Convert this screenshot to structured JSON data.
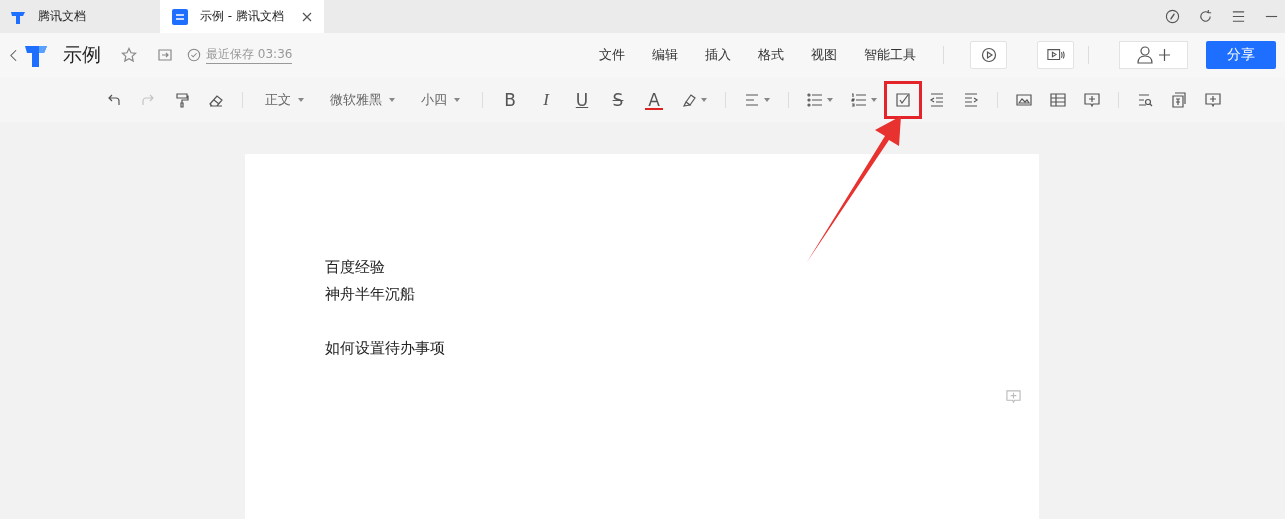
{
  "tabs": [
    {
      "label": "腾讯文档",
      "selected": false,
      "closable": false
    },
    {
      "label": "示例 - 腾讯文档",
      "selected": true,
      "closable": true
    }
  ],
  "header": {
    "title": "示例",
    "save_status": "最近保存 03:36",
    "menus": [
      "文件",
      "编辑",
      "插入",
      "格式",
      "视图",
      "智能工具"
    ],
    "share_button": "分享"
  },
  "toolbar": [
    {
      "kind": "undo",
      "disabled": false,
      "highlighted": false
    },
    {
      "kind": "redo",
      "disabled": true,
      "highlighted": false
    },
    {
      "kind": "painter",
      "disabled": false,
      "highlighted": false
    },
    {
      "kind": "eraser",
      "disabled": false,
      "highlighted": false
    },
    {
      "kind": "sep"
    },
    {
      "kind": "dropdown",
      "label": "正文",
      "disabled": false,
      "highlighted": false
    },
    {
      "kind": "dropdown",
      "label": "微软雅黑",
      "disabled": false,
      "highlighted": false
    },
    {
      "kind": "dropdown",
      "label": "小四",
      "disabled": false,
      "highlighted": false
    },
    {
      "kind": "sep"
    },
    {
      "kind": "bold",
      "label": "B",
      "disabled": false,
      "highlighted": false
    },
    {
      "kind": "italic",
      "label": "I",
      "disabled": false,
      "highlighted": false
    },
    {
      "kind": "underline",
      "label": "U",
      "disabled": false,
      "highlighted": false
    },
    {
      "kind": "strike",
      "label": "S",
      "disabled": false,
      "highlighted": false
    },
    {
      "kind": "color",
      "label": "A",
      "disabled": false,
      "highlighted": false
    },
    {
      "kind": "highlight",
      "disabled": false,
      "highlighted": false
    },
    {
      "kind": "sep"
    },
    {
      "kind": "align",
      "disabled": false,
      "highlighted": false
    },
    {
      "kind": "sep"
    },
    {
      "kind": "bullets",
      "disabled": false,
      "highlighted": false
    },
    {
      "kind": "numbers",
      "disabled": false,
      "highlighted": false
    },
    {
      "kind": "checklist",
      "disabled": false,
      "highlighted": true
    },
    {
      "kind": "outdent",
      "disabled": false,
      "highlighted": false
    },
    {
      "kind": "indent",
      "disabled": false,
      "highlighted": false
    },
    {
      "kind": "sep"
    },
    {
      "kind": "image",
      "disabled": false,
      "highlighted": false
    },
    {
      "kind": "table",
      "disabled": false,
      "highlighted": false
    },
    {
      "kind": "comment",
      "disabled": false,
      "highlighted": false
    },
    {
      "kind": "sep"
    },
    {
      "kind": "find",
      "disabled": false,
      "highlighted": false
    },
    {
      "kind": "translate",
      "disabled": false,
      "highlighted": false
    },
    {
      "kind": "comment",
      "disabled": false,
      "highlighted": false
    }
  ],
  "document": {
    "blocks": [
      {
        "lines": [
          "百度经验",
          "神舟半年沉船"
        ]
      },
      {
        "lines": [
          "如何设置待办事项"
        ]
      }
    ]
  }
}
